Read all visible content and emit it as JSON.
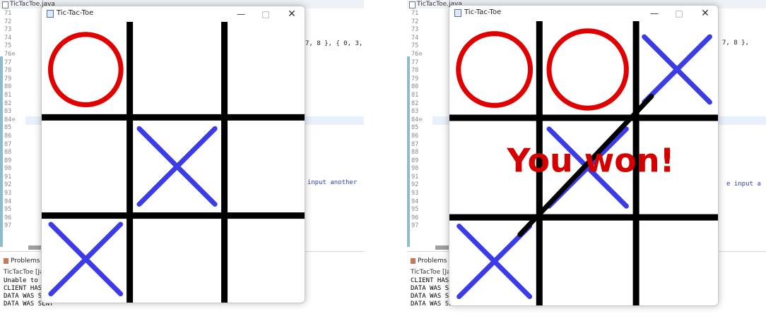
{
  "panels": [
    {
      "id": "left",
      "editor_tab": "TicTacToe.java",
      "line_numbers": [
        "71",
        "72",
        "73",
        "74",
        "75",
        "76⊖",
        "77",
        "78",
        "79",
        "80",
        "81",
        "82",
        "83",
        "84⊖",
        "85",
        "86",
        "87",
        "88",
        "89",
        "90",
        "91",
        "92",
        "93",
        "94",
        "95",
        "96",
        "97"
      ],
      "code_fragments": [
        "7, 8 }, { 0, 3,",
        "e input another"
      ],
      "problems_tab": "Problems",
      "console_title": "TicTacToe [Jav",
      "console_lines": [
        "Unable to",
        "CLIENT HAS",
        "DATA WAS S",
        "DATA WAS SENT"
      ],
      "window": {
        "title": "Tic-Tac-Toe",
        "minimize_glyph": "—",
        "maximize_glyph": "□",
        "close_glyph": "✕"
      },
      "board": {
        "cells": [
          "O",
          "",
          "",
          "",
          "X",
          "",
          "X",
          "",
          ""
        ],
        "message": "",
        "win_line": null
      }
    },
    {
      "id": "right",
      "editor_tab": "TicTacToe.java",
      "line_numbers": [
        "71",
        "72",
        "73",
        "74",
        "75",
        "76⊖",
        "77",
        "78",
        "79",
        "80",
        "81",
        "82",
        "83",
        "84⊖",
        "85",
        "86",
        "87",
        "88",
        "89",
        "90",
        "91",
        "92",
        "93",
        "94",
        "95",
        "96",
        "97"
      ],
      "code_fragments": [
        "7, 8 },",
        "e input a"
      ],
      "problems_tab": "Problems",
      "console_title": "TicTacToe [Jav",
      "console_lines": [
        "CLIENT HAS",
        "DATA WAS S",
        "DATA WAS S",
        "DATA WAS SENT"
      ],
      "window": {
        "title": "Tic-Tac-Toe",
        "minimize_glyph": "—",
        "maximize_glyph": "□",
        "close_glyph": "✕"
      },
      "board": {
        "cells": [
          "O",
          "O",
          "X",
          "",
          "X",
          "",
          "X",
          "",
          ""
        ],
        "message": "You won!",
        "win_line": [
          2,
          6
        ]
      }
    }
  ],
  "colors": {
    "o_mark": "#e00000",
    "x_mark": "#3b3be8",
    "grid": "#000000",
    "message": "#d40000",
    "win_line": "#000000"
  }
}
